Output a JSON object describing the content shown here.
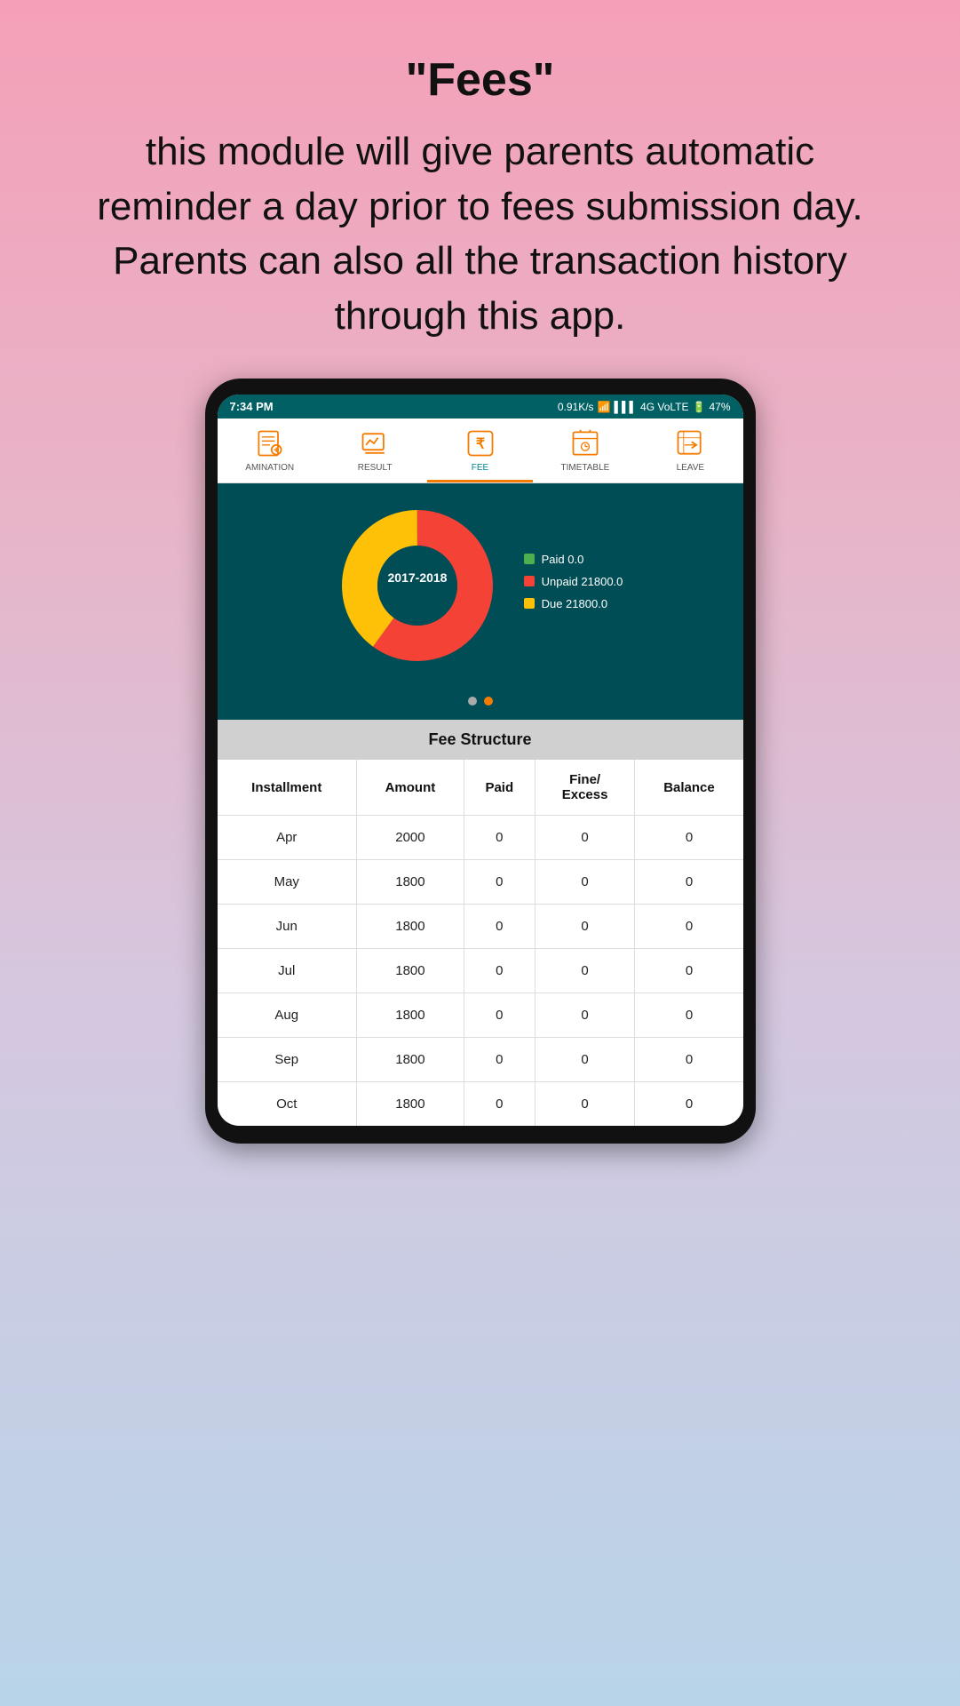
{
  "header": {
    "title": "\"Fees\"",
    "description": "this module will give parents automatic reminder a day prior to fees submission day. Parents can also all the transaction history through this app."
  },
  "statusBar": {
    "time": "7:34 PM",
    "network": "0.91K/s",
    "battery": "47%",
    "networkType": "4G VoLTE"
  },
  "navTabs": [
    {
      "label": "AMINATION",
      "active": false
    },
    {
      "label": "RESULT",
      "active": false
    },
    {
      "label": "FEE",
      "active": true
    },
    {
      "label": "TIMETABLE",
      "active": false
    },
    {
      "label": "LEAVE",
      "active": false
    }
  ],
  "chart": {
    "year": "2017-2018",
    "legend": [
      {
        "color": "green",
        "label": "Paid 0.0"
      },
      {
        "color": "red",
        "label": "Unpaid 21800.0"
      },
      {
        "color": "yellow",
        "label": "Due 21800.0"
      }
    ]
  },
  "feeStructure": {
    "title": "Fee Structure",
    "columns": [
      "Installment",
      "Amount",
      "Paid",
      "Fine/\nExcess",
      "Balance"
    ],
    "rows": [
      {
        "installment": "Apr",
        "amount": "2000",
        "paid": "0",
        "fine": "0",
        "balance": "0"
      },
      {
        "installment": "May",
        "amount": "1800",
        "paid": "0",
        "fine": "0",
        "balance": "0"
      },
      {
        "installment": "Jun",
        "amount": "1800",
        "paid": "0",
        "fine": "0",
        "balance": "0"
      },
      {
        "installment": "Jul",
        "amount": "1800",
        "paid": "0",
        "fine": "0",
        "balance": "0"
      },
      {
        "installment": "Aug",
        "amount": "1800",
        "paid": "0",
        "fine": "0",
        "balance": "0"
      },
      {
        "installment": "Sep",
        "amount": "1800",
        "paid": "0",
        "fine": "0",
        "balance": "0"
      },
      {
        "installment": "Oct",
        "amount": "1800",
        "paid": "0",
        "fine": "0",
        "balance": "0"
      }
    ]
  }
}
